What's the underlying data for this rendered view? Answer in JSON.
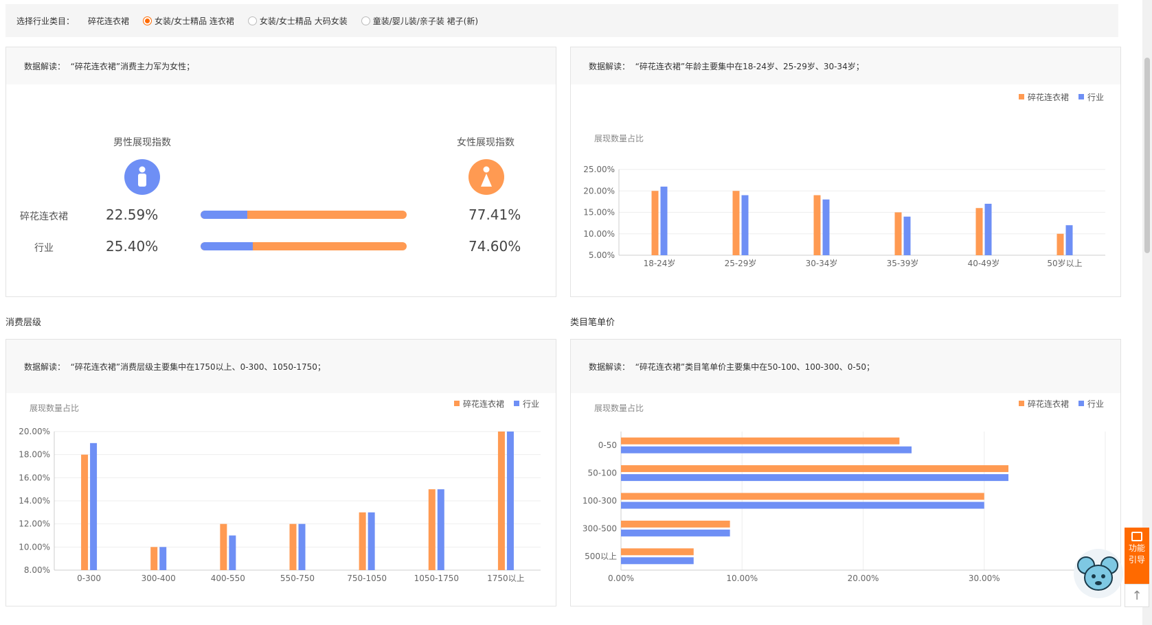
{
  "filter": {
    "label": "选择行业类目：",
    "current": "碎花连衣裙",
    "options": [
      {
        "label": "女装/女士精品 连衣裙",
        "selected": true
      },
      {
        "label": "女装/女士精品 大码女装",
        "selected": false
      },
      {
        "label": "童装/婴儿装/亲子装 裙子(新)",
        "selected": false
      }
    ]
  },
  "gender": {
    "note_label": "数据解读：",
    "note_text": "“碎花连衣裙”消费主力军为女性；",
    "male_head": "男性展现指数",
    "female_head": "女性展现指数",
    "rows": [
      {
        "label": "碎花连衣裙",
        "male": "22.59%",
        "female": "77.41%",
        "male_share": 0.2259
      },
      {
        "label": "行业",
        "male": "25.40%",
        "female": "74.60%",
        "male_share": 0.254
      }
    ],
    "colors": {
      "male": "#6e8ff5",
      "female": "#ff9a52"
    }
  },
  "age": {
    "note_label": "数据解读：",
    "note_text": "“碎花连衣裙”年龄主要集中在18-24岁、25-29岁、30-34岁；"
  },
  "consumption": {
    "section_title": "消费层级",
    "note_label": "数据解读：",
    "note_text": "“碎花连衣裙”消费层级主要集中在1750以上、0-300、1050-1750；"
  },
  "unit_price": {
    "section_title": "类目笔单价",
    "note_label": "数据解读：",
    "note_text": "“碎花连衣裙”类目笔单价主要集中在50-100、100-300、0-50；"
  },
  "side_widget": {
    "guide_line1": "功能",
    "guide_line2": "引导",
    "to_top": "↑"
  },
  "chart_data": [
    {
      "id": "age",
      "type": "bar",
      "ylabel": "展现数量占比",
      "categories": [
        "18-24岁",
        "25-29岁",
        "30-34岁",
        "35-39岁",
        "40-49岁",
        "50岁以上"
      ],
      "series": [
        {
          "name": "碎花连衣裙",
          "color": "#ff9a52",
          "values": [
            20,
            20,
            19,
            15,
            16,
            10
          ]
        },
        {
          "name": "行业",
          "color": "#6e8ff5",
          "values": [
            21,
            19,
            18,
            14,
            17,
            12
          ]
        }
      ],
      "ylim": [
        5,
        25
      ],
      "yticks": [
        "5.00%",
        "10.00%",
        "15.00%",
        "20.00%",
        "25.00%"
      ],
      "legend": "top-right",
      "grid": true
    },
    {
      "id": "consumption",
      "type": "bar",
      "ylabel": "展现数量占比",
      "categories": [
        "0-300",
        "300-400",
        "400-550",
        "550-750",
        "750-1050",
        "1050-1750",
        "1750以上"
      ],
      "series": [
        {
          "name": "碎花连衣裙",
          "color": "#ff9a52",
          "values": [
            18,
            10,
            12,
            12,
            13,
            15,
            20
          ]
        },
        {
          "name": "行业",
          "color": "#6e8ff5",
          "values": [
            19,
            10,
            11,
            12,
            13,
            15,
            20
          ]
        }
      ],
      "ylim": [
        8,
        20
      ],
      "yticks": [
        "8.00%",
        "10.00%",
        "12.00%",
        "14.00%",
        "16.00%",
        "18.00%",
        "20.00%"
      ],
      "legend": "top-right",
      "grid": true
    },
    {
      "id": "unit_price",
      "type": "bar",
      "orientation": "horizontal",
      "ylabel": "展现数量占比",
      "categories": [
        "0-50",
        "50-100",
        "100-300",
        "300-500",
        "500以上"
      ],
      "series": [
        {
          "name": "碎花连衣裙",
          "color": "#ff9a52",
          "values": [
            23,
            32,
            30,
            9,
            6
          ]
        },
        {
          "name": "行业",
          "color": "#6e8ff5",
          "values": [
            24,
            32,
            30,
            9,
            6
          ]
        }
      ],
      "xlim": [
        0,
        40
      ],
      "xticks": [
        "0.00%",
        "10.00%",
        "20.00%",
        "30.00%"
      ],
      "legend": "top-right",
      "grid": true
    }
  ]
}
